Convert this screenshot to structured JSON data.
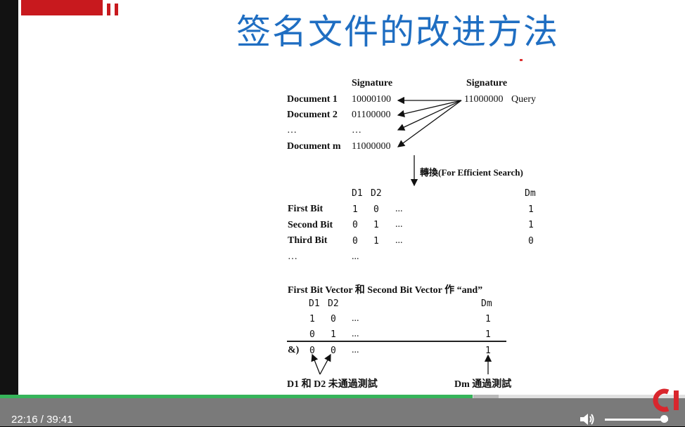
{
  "slide": {
    "title": "签名文件的改进方法",
    "section1": {
      "header_left": "Signature",
      "header_right": "Signature",
      "documents": [
        {
          "label": "Document 1",
          "signature": "10000100"
        },
        {
          "label": "Document 2",
          "signature": "01100000"
        },
        {
          "label": "…",
          "signature": "…"
        },
        {
          "label": "Document m",
          "signature": "11000000"
        }
      ],
      "query_signature": "11000000",
      "query_label": "Query"
    },
    "transform_label": "轉換(For Efficient Search)",
    "section2": {
      "col_d1": "D1",
      "col_d2": "D2",
      "col_dm": "Dm",
      "rows": [
        {
          "label": "First Bit",
          "d1": "1",
          "d2": "0",
          "ellipsis": "...",
          "dm": "1"
        },
        {
          "label": "Second Bit",
          "d1": "0",
          "d2": "1",
          "ellipsis": "...",
          "dm": "1"
        },
        {
          "label": "Third Bit",
          "d1": "0",
          "d2": "1",
          "ellipsis": "...",
          "dm": "0"
        },
        {
          "label": "…",
          "d1": "...",
          "d2": "",
          "ellipsis": "",
          "dm": ""
        }
      ]
    },
    "section3": {
      "caption": "First Bit Vector  和  Second Bit Vector  作 “and”",
      "col_d1": "D1",
      "col_d2": "D2",
      "col_dm": "Dm",
      "rows": [
        {
          "prefix": "",
          "d1": "1",
          "d2": "0",
          "ellipsis": "...",
          "dm": "1"
        },
        {
          "prefix": "",
          "d1": "0",
          "d2": "1",
          "ellipsis": "...",
          "dm": "1"
        },
        {
          "prefix": "&)",
          "d1": "0",
          "d2": "0",
          "ellipsis": "...",
          "dm": "1"
        }
      ],
      "fail_note": "D1  和  D2  未通過測試",
      "pass_note": "Dm  通過測試"
    }
  },
  "player": {
    "current_time": "22:16",
    "separator": "/",
    "duration": "39:41",
    "progress": 0.69,
    "volume": 0.93,
    "volume_icon": "speaker-icon",
    "logo_text": "CI"
  },
  "colors": {
    "title": "#1f6ec2",
    "brand_red": "#c8191e",
    "progress": "#36b45a",
    "controls_bg": "#7a7a7a"
  }
}
